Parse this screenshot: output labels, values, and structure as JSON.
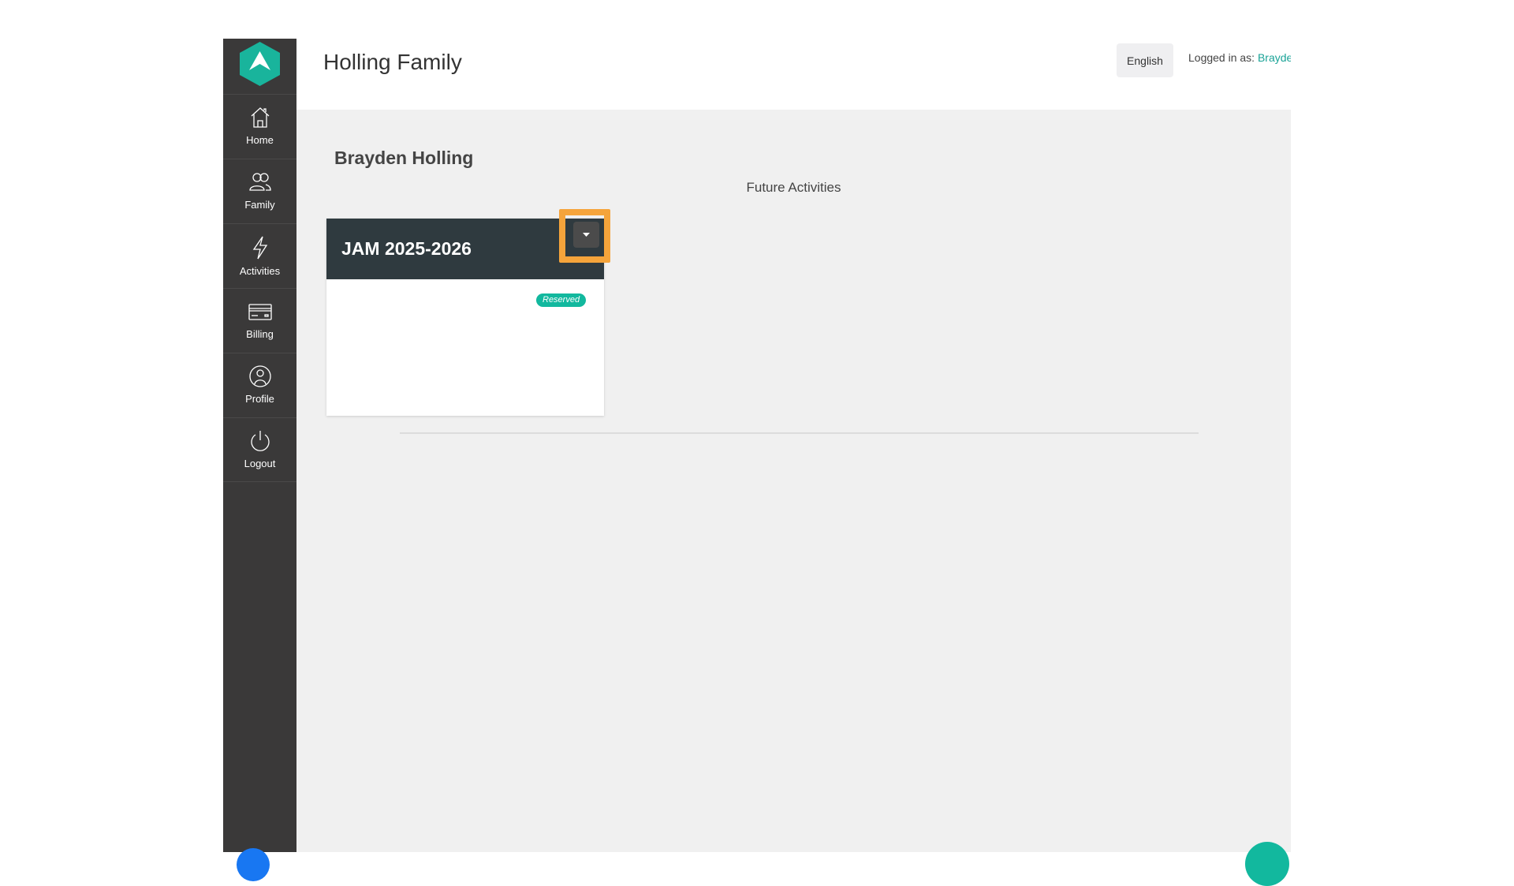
{
  "header": {
    "title": "Holling Family",
    "language": "English",
    "logged_in_prefix": "Logged in as:",
    "user_name": "Brayden Holling"
  },
  "sidebar": {
    "items": [
      {
        "label": "Home",
        "icon": "home-icon"
      },
      {
        "label": "Family",
        "icon": "family-icon"
      },
      {
        "label": "Activities",
        "icon": "lightning-icon"
      },
      {
        "label": "Billing",
        "icon": "credit-card-icon"
      },
      {
        "label": "Profile",
        "icon": "profile-icon"
      },
      {
        "label": "Logout",
        "icon": "power-icon"
      }
    ]
  },
  "main": {
    "member_name": "Brayden Holling",
    "section_title": "Future Activities",
    "activity_card": {
      "title": "JAM 2025-2026",
      "status": "Reserved"
    }
  },
  "colors": {
    "sidebar_bg": "#3a3939",
    "accent": "#1aa397",
    "card_header": "#2f3a3f",
    "badge": "#12b89e",
    "highlight": "#f5a43b"
  }
}
